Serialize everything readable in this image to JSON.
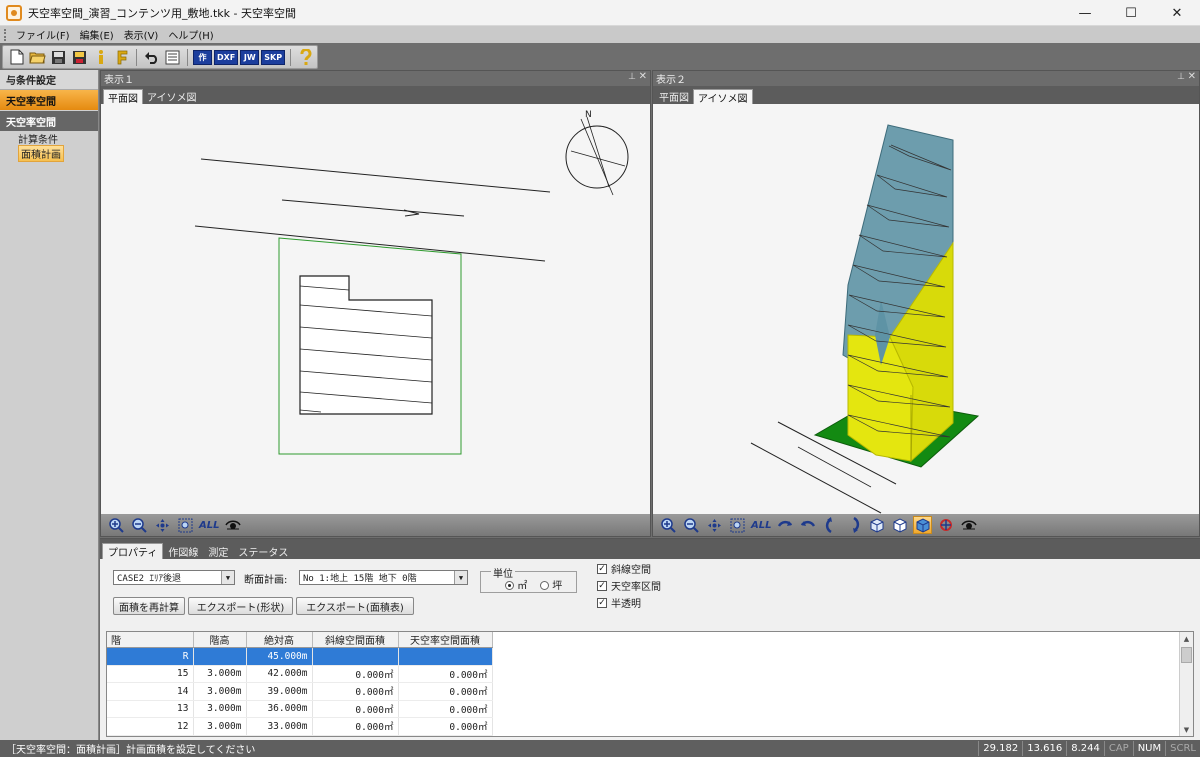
{
  "window": {
    "title": "天空率空間_演習_コンテンツ用_敷地.tkk - 天空率空間",
    "minimize": "—",
    "maximize": "☐",
    "close": "✕"
  },
  "menu": {
    "file": "ファイル(F)",
    "edit": "編集(E)",
    "view": "表示(V)",
    "help": "ヘルプ(H)"
  },
  "toolbar": {
    "tag_saku": "作",
    "tag_dxf": "DXF",
    "tag_jw": "JW",
    "tag_skp": "SKP",
    "icons": [
      "new-file-icon",
      "open-folder-icon",
      "save-icon",
      "save-all-icon",
      "info-icon",
      "font-icon",
      "undo-icon",
      "list-icon",
      "help-icon"
    ]
  },
  "sidebar": {
    "cond_header": "与条件設定",
    "active_header": "天空率空間",
    "dark_header": "天空率空間",
    "items": [
      {
        "label": "計算条件"
      },
      {
        "label": "面積計画"
      }
    ]
  },
  "view1": {
    "title": "表示１",
    "tabs": [
      {
        "label": "平面図"
      },
      {
        "label": "アイソメ図"
      }
    ],
    "active_tab": "平面図",
    "footer_all": "ALL"
  },
  "view2": {
    "title": "表示２",
    "tabs": [
      {
        "label": "平面図"
      },
      {
        "label": "アイソメ図"
      }
    ],
    "active_tab": "アイソメ図",
    "footer_all": "ALL"
  },
  "panel": {
    "tabs": [
      {
        "label": "プロパティ"
      },
      {
        "label": "作図線"
      },
      {
        "label": "測定"
      },
      {
        "label": "ステータス"
      }
    ],
    "case_select": "CASE2 ｴﾘｱ後退",
    "section_label": "断面計画:",
    "section_select": "No  1:地上 15階 地下  0階",
    "recalc_button": "面積を再計算",
    "export_shape_button": "エクスポート(形状)",
    "export_area_button": "エクスポート(面積表)",
    "unit_group": "単位",
    "unit_m2": "㎡",
    "unit_tsubo": "坪",
    "unit_selected": "m2",
    "checks": [
      {
        "label": "斜線空間",
        "checked": true
      },
      {
        "label": "天空率区間",
        "checked": true
      },
      {
        "label": "半透明",
        "checked": true
      }
    ]
  },
  "table": {
    "columns": [
      "階",
      "階高",
      "絶対高",
      "斜線空間面積",
      "天空率空間面積"
    ],
    "rows": [
      {
        "floor": "R",
        "height": "",
        "abs": "45.000m",
        "slant": "",
        "sky": ""
      },
      {
        "floor": "15",
        "height": "3.000m",
        "abs": "42.000m",
        "slant": "0.000㎡",
        "sky": "0.000㎡"
      },
      {
        "floor": "14",
        "height": "3.000m",
        "abs": "39.000m",
        "slant": "0.000㎡",
        "sky": "0.000㎡"
      },
      {
        "floor": "13",
        "height": "3.000m",
        "abs": "36.000m",
        "slant": "0.000㎡",
        "sky": "0.000㎡"
      },
      {
        "floor": "12",
        "height": "3.000m",
        "abs": "33.000m",
        "slant": "0.000㎡",
        "sky": "0.000㎡"
      }
    ]
  },
  "status": {
    "message": "［天空率空間：面積計画］計画面積を設定してください",
    "x": "29.182",
    "y": "13.616",
    "z": "8.244",
    "cap": "CAP",
    "num": "NUM",
    "scrl": "SCRL"
  },
  "colors": {
    "accent_orange": "#e58a10",
    "building_yellow": "#e4e60f",
    "building_blue": "#5e93a5",
    "site_green": "#138a12",
    "selection_blue": "#2f7bd6"
  }
}
